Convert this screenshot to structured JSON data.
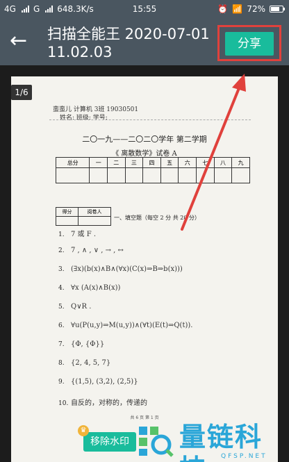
{
  "status_bar": {
    "network1": "4G",
    "network2": "G",
    "speed": "648.3K/s",
    "time": "15:55",
    "battery": "72%",
    "battery_fraction": 0.72
  },
  "app_bar": {
    "title": "扫描全能王 2020-07-01 11.02.03",
    "share_label": "分享"
  },
  "viewer": {
    "page_indicator": "1/6",
    "doc": {
      "header_line1": "蛮蛮儿 计算机 3班 19030501",
      "header_line2": "姓名: 班级: 学号:",
      "year_line": "二〇一九——二〇二〇学年    第二学期",
      "exam_title": "《 离散数学》试卷 A",
      "score_headers": [
        "总分",
        "一",
        "二",
        "三",
        "四",
        "五",
        "六",
        "七",
        "八",
        "九"
      ],
      "grader_headers": [
        "得分",
        "阅卷人"
      ],
      "section_title": "一、填空题（每空 2 分 共 20 分）",
      "answers": [
        {
          "num": "1.",
          "text": "7 或 F ."
        },
        {
          "num": "2.",
          "text": "7 , ∧ , ∨ , → , ↔"
        },
        {
          "num": "3.",
          "text": "(∃x)(b(x)∧B∧(∀x)(C(x)⇒B⇒b(x)))"
        },
        {
          "num": "4.",
          "text": "∀x (A(x)∧B(x))"
        },
        {
          "num": "5.",
          "text": "Q∨R ."
        },
        {
          "num": "6.",
          "text": "∀u(P(u,y)⇒M(u,y))∧(∀t)(E(t)⇒Q(t))."
        },
        {
          "num": "7.",
          "text": "{Φ, {Φ}}"
        },
        {
          "num": "8.",
          "text": "{2, 4, 5, 7}"
        },
        {
          "num": "9.",
          "text": "{(1,5), (3,2), (2,5)}"
        },
        {
          "num": "10.",
          "text": "自反的，对称的，传递的"
        }
      ],
      "page_footer": "共 6 页 第 1 页"
    }
  },
  "remove_watermark_label": "移除水印",
  "brand": {
    "name": "量链科技",
    "url": "QFSP.NET"
  }
}
